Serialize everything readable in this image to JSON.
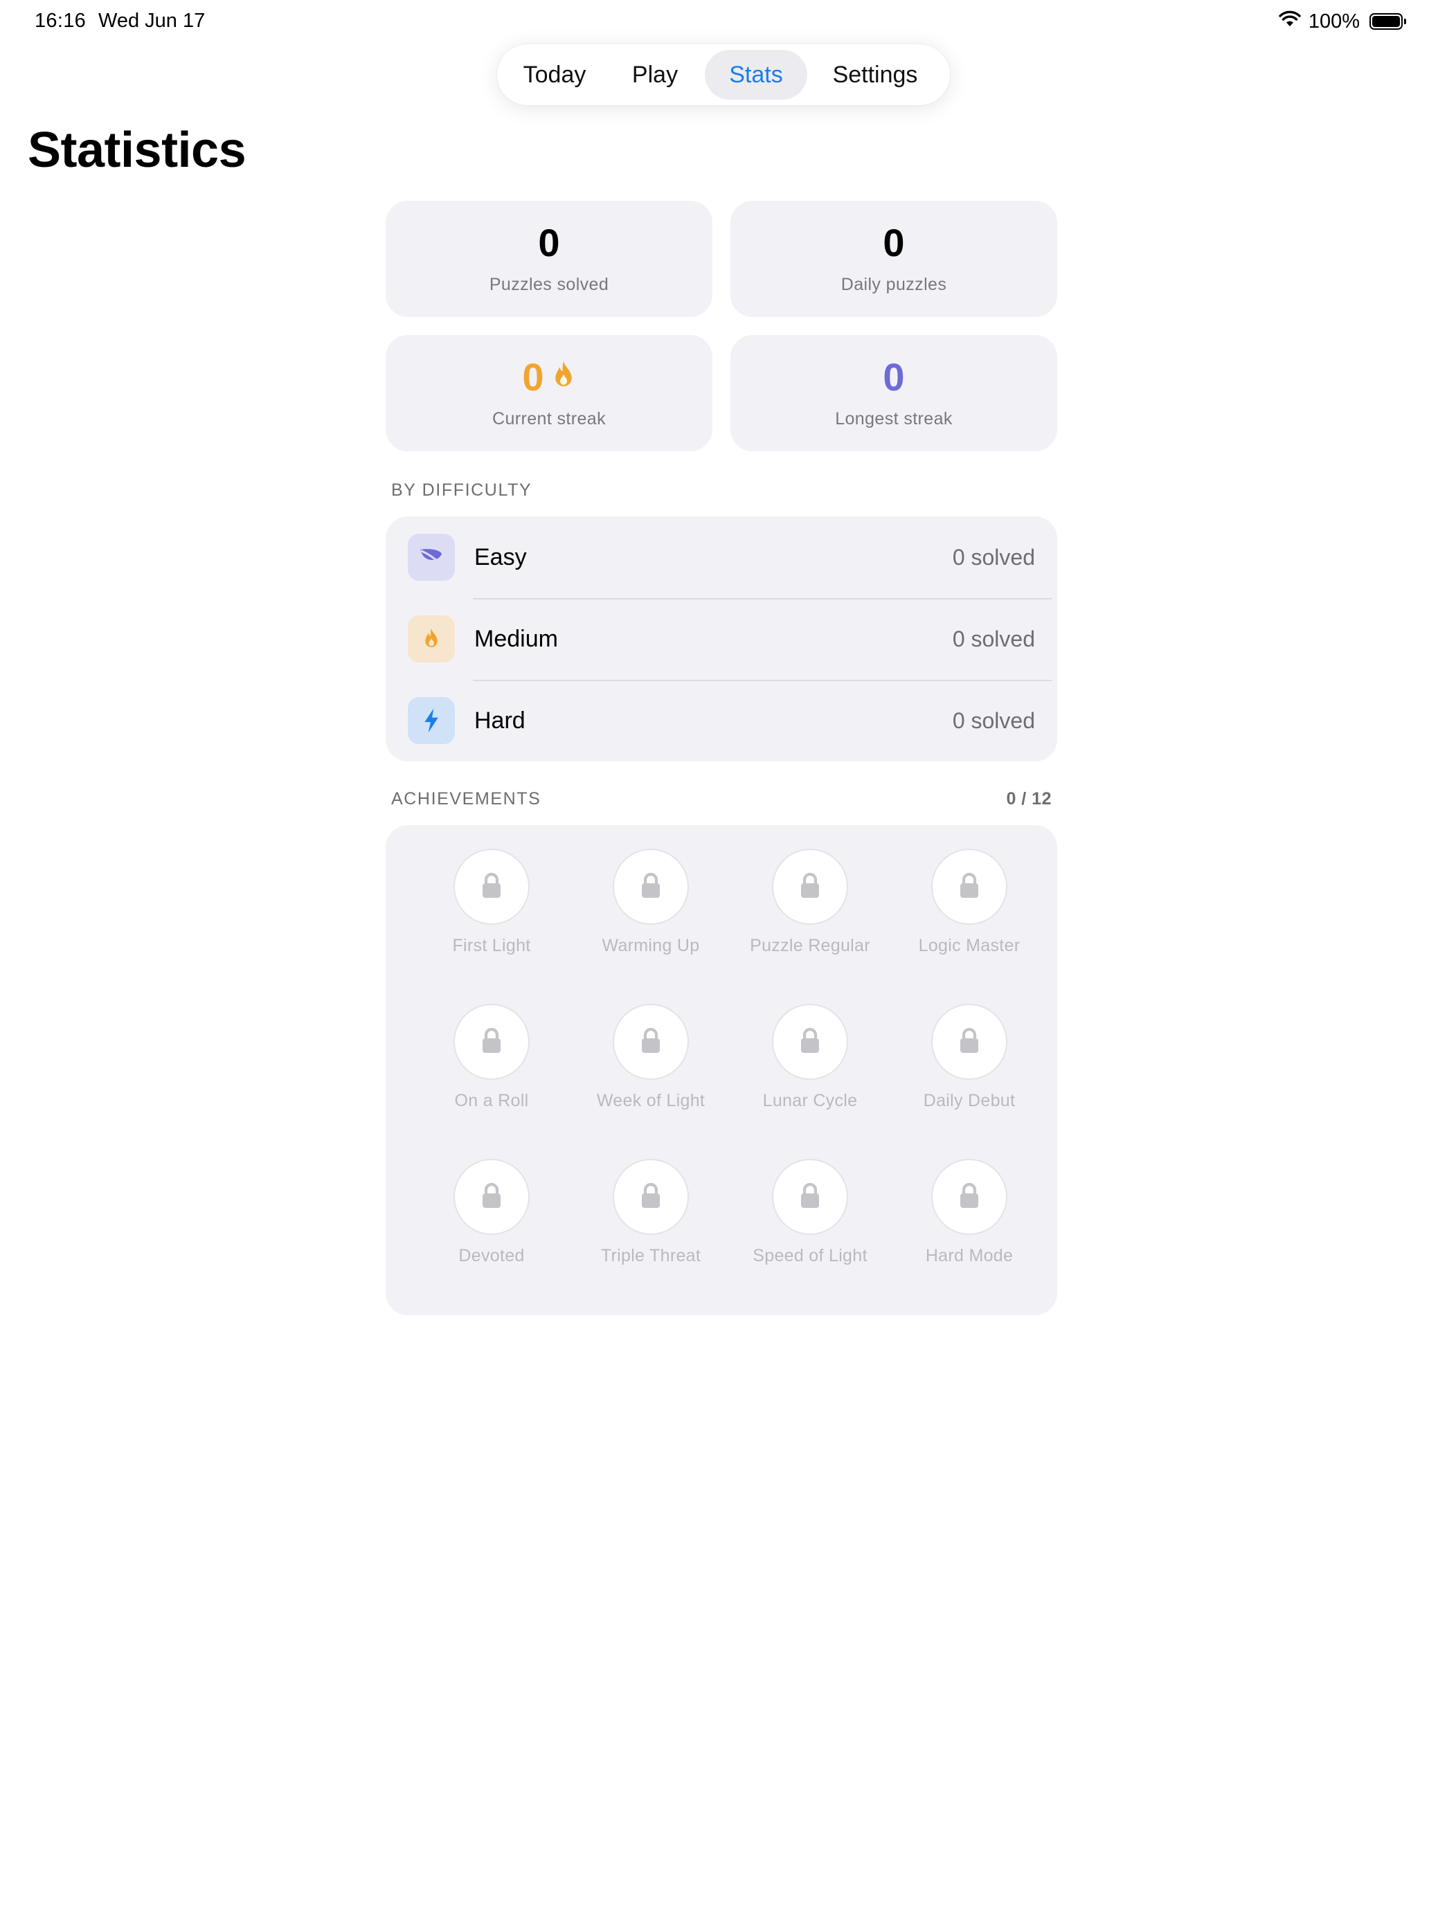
{
  "status_bar": {
    "time": "16:16",
    "date": "Wed Jun 17",
    "battery": "100%"
  },
  "tabs": [
    {
      "label": "Today",
      "active": false
    },
    {
      "label": "Play",
      "active": false
    },
    {
      "label": "Stats",
      "active": true
    },
    {
      "label": "Settings",
      "active": false
    }
  ],
  "page_title": "Statistics",
  "stats": {
    "puzzles_solved": {
      "value": "0",
      "label": "Puzzles solved"
    },
    "daily_puzzles": {
      "value": "0",
      "label": "Daily puzzles"
    },
    "current_streak": {
      "value": "0",
      "label": "Current streak",
      "icon": "flame-icon"
    },
    "longest_streak": {
      "value": "0",
      "label": "Longest streak"
    }
  },
  "by_difficulty": {
    "heading": "BY DIFFICULTY",
    "rows": [
      {
        "name": "Easy",
        "count": "0 solved",
        "icon": "leaf-icon"
      },
      {
        "name": "Medium",
        "count": "0 solved",
        "icon": "flame-icon"
      },
      {
        "name": "Hard",
        "count": "0 solved",
        "icon": "bolt-icon"
      }
    ]
  },
  "achievements": {
    "heading": "ACHIEVEMENTS",
    "count": "0 / 12",
    "items": [
      "First Light",
      "Warming Up",
      "Puzzle Regular",
      "Logic Master",
      "On a Roll",
      "Week of Light",
      "Lunar Cycle",
      "Daily Debut",
      "Devoted",
      "Triple Threat",
      "Speed of Light",
      "Hard Mode"
    ]
  },
  "colors": {
    "accent_blue": "#1a7ee8",
    "streak_orange": "#f0a530",
    "longest_purple": "#6e6ad6",
    "card_bg": "#f2f2f6"
  }
}
